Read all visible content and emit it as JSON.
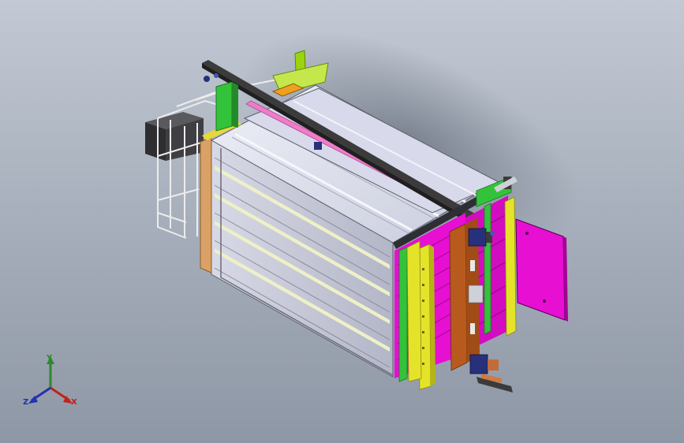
{
  "viewport": {
    "background_top": "#c2c9d4",
    "background_bottom": "#8e97a5"
  },
  "model": {
    "colors": {
      "panel_light": "#dcdde8",
      "panel_dark": "#b9bccc",
      "frame_dark": "#3b3b3b",
      "magenta": "#e60fd2",
      "pink": "#ef7cc8",
      "yellow": "#e4e32a",
      "green": "#33c33a",
      "lime": "#9ad40f",
      "orange_brown": "#b85a1e",
      "tan": "#d9a166",
      "navy": "#27307a",
      "grey_rail": "#cfd1d8"
    }
  },
  "triad": {
    "x_label": "X",
    "y_label": "Y",
    "z_label": "Z",
    "x_color": "#c0221c",
    "y_color": "#2c8a2c",
    "z_color": "#2233b0"
  }
}
